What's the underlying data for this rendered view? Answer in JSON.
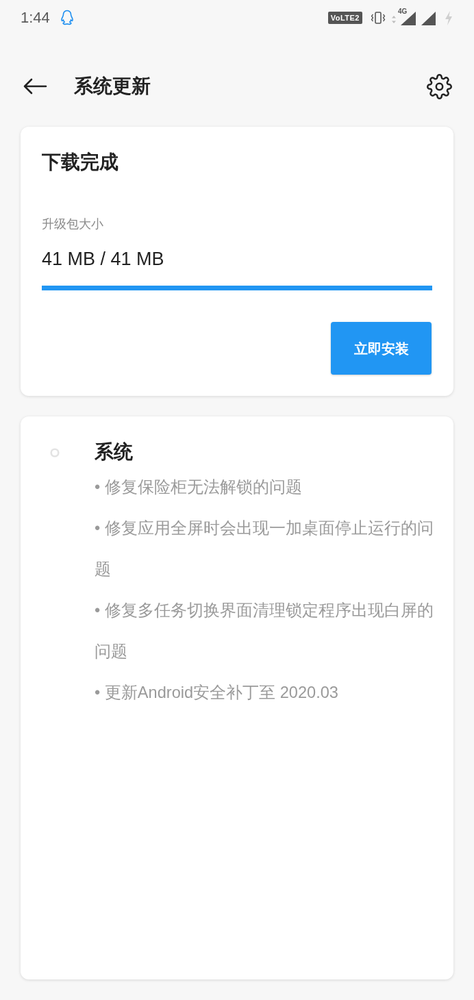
{
  "status_bar": {
    "time": "1:44",
    "network_badge": "VoLTE2",
    "network_type": "4G"
  },
  "header": {
    "title": "系统更新"
  },
  "download_card": {
    "title": "下载完成",
    "size_label": "升级包大小",
    "size_value": "41 MB / 41 MB",
    "progress": {
      "level": 1
    },
    "install_button": "立即安装"
  },
  "changelog_card": {
    "section_title": "系统",
    "items": [
      "• 修复保险柜无法解锁的问题",
      "• 修复应用全屏时会出现一加桌面停止运行的问题",
      "• 修复多任务切换界面清理锁定程序出现白屏的问题",
      "• 更新Android安全补丁至 2020.03"
    ]
  }
}
